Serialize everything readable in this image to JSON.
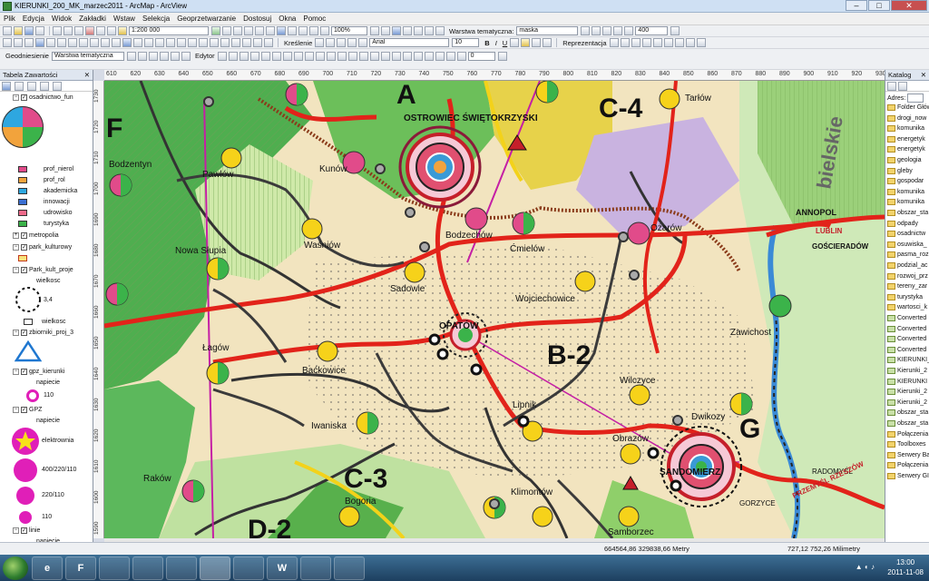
{
  "window": {
    "title": "KIERUNKI_200_MK_marzec2011 - ArcMap - ArcView"
  },
  "menu": [
    "Plik",
    "Edycja",
    "Widok",
    "Zakładki",
    "Wstaw",
    "Selekcja",
    "Geoprzetwarzanie",
    "Dostosuj",
    "Okna",
    "Pomoc"
  ],
  "toolbar": {
    "scale": "1:200 000",
    "thematic_layer_label": "Warstwa tematyczna:",
    "thematic_layer_value": "maska",
    "zoom": "100%",
    "value_400": "400",
    "drawing_label": "Kreślenie",
    "font": "Arial",
    "font_size": "10",
    "bold": "B",
    "italic": "I",
    "underline": "U",
    "presentation_label": "Reprezentacja",
    "georef_label": "Geodniesienie",
    "georef_layer": "Warstwa tematyczna",
    "editor_label": "Edytor",
    "last_field": "0"
  },
  "toc": {
    "title": "Tabela Zawartości",
    "items": [
      {
        "label": "osadnictwo_fun",
        "checked": true
      },
      {
        "label": "prof_nierol",
        "color": "#e14b8a"
      },
      {
        "label": "prof_rol",
        "color": "#f2a33c"
      },
      {
        "label": "akademicka",
        "color": "#2ea7e0"
      },
      {
        "label": "innowacji",
        "color": "#3b6fd1"
      },
      {
        "label": "udrowisko",
        "color": "#ef6a8a"
      },
      {
        "label": "turystyka",
        "color": "#3bb34a"
      },
      {
        "label": "metropolia",
        "checked": true
      },
      {
        "label": "park_kulturowy",
        "checked": true
      },
      {
        "label": "Park_kult_proje",
        "checked": true
      },
      {
        "label": "wielkosc"
      },
      {
        "label": "3,4"
      },
      {
        "label": "wielkosc"
      },
      {
        "label": "zbiorniki_proj_3",
        "checked": true
      },
      {
        "label": "gpz_kierunki",
        "checked": true
      },
      {
        "label": "napiecie"
      },
      {
        "label": "110"
      },
      {
        "label": "GPZ",
        "checked": true
      },
      {
        "label": "napiecie"
      },
      {
        "label": "elektrownia"
      },
      {
        "label": "400/220/110"
      },
      {
        "label": "220/110"
      },
      {
        "label": "110"
      },
      {
        "label": "linie",
        "checked": true
      },
      {
        "label": "napiecie"
      }
    ]
  },
  "catalog": {
    "title": "Katalog",
    "address_label": "Adres:",
    "items": [
      "Folder Główny",
      "drogi_now",
      "komunika",
      "energetyk",
      "energetyk",
      "geologia",
      "gleby",
      "gospodar",
      "komunika",
      "komunika",
      "obszar_sta",
      "odpady",
      "osadnictw",
      "osuwiska_",
      "pasma_roz",
      "podzial_ac",
      "rozwoj_prz",
      "tereny_zar",
      "turystyka",
      "wartosci_k",
      "Converted",
      "Converted",
      "Converted",
      "Converted",
      "KIERUNKI_2",
      "Kierunki_2",
      "KIERUNKI",
      "Kierunki_2",
      "Kierunki_2",
      "obszar_sta",
      "obszar_sta",
      "Połączenia Fo",
      "Toolboxes",
      "Serwery Baz D",
      "Połączenia Z E",
      "Serwery GIS"
    ]
  },
  "map": {
    "big_letters": [
      "A",
      "C-4",
      "F",
      "B-2",
      "C-3",
      "G",
      "D-2"
    ],
    "towns": [
      "OSTROWIEC ŚWIĘTOKRZYSKI",
      "OPATÓW",
      "SANDOMIERZ",
      "Kunów",
      "Bodzentyn",
      "Pawłów",
      "Waśniów",
      "Nowa Słupia",
      "Sadowie",
      "Bodzechów",
      "Ćmielów",
      "Ożarów",
      "Wojciechowice",
      "Tarłów",
      "Zawichost",
      "Łagów",
      "Baćkowice",
      "Iwaniska",
      "Lipnik",
      "Wilczyce",
      "Dwikozy",
      "Obrazów",
      "Raków",
      "Bogoria",
      "Klimontów",
      "Samborzec",
      "ANNOPOL",
      "LUBLIN",
      "GOŚCIERADÓW",
      "RADOMYŚL",
      "PRZEMYŚL RZESZÓW",
      "GORZYCE",
      "bielskie"
    ],
    "ruler_top": [
      "610",
      "620",
      "630",
      "640",
      "650",
      "660",
      "670",
      "680",
      "690",
      "700",
      "710",
      "720",
      "730",
      "740",
      "750",
      "760",
      "770",
      "780",
      "790",
      "800",
      "810",
      "820",
      "830",
      "840",
      "850",
      "860",
      "870",
      "880",
      "890",
      "900",
      "910",
      "920",
      "930"
    ],
    "ruler_left": [
      "1590",
      "1600",
      "1610",
      "1620",
      "1630",
      "1640",
      "1650",
      "1660",
      "1670",
      "1680",
      "1690",
      "1700",
      "1710",
      "1720",
      "1730"
    ]
  },
  "status": {
    "coords": "664564,86  329838,66 Metry",
    "page_coords": "727,12  752,26 Milimetry"
  },
  "taskbar": {
    "time": "13:00",
    "date": "2011-11-08",
    "apps": [
      "e",
      "F",
      "",
      "",
      "",
      "",
      "",
      "W",
      "",
      ""
    ]
  }
}
